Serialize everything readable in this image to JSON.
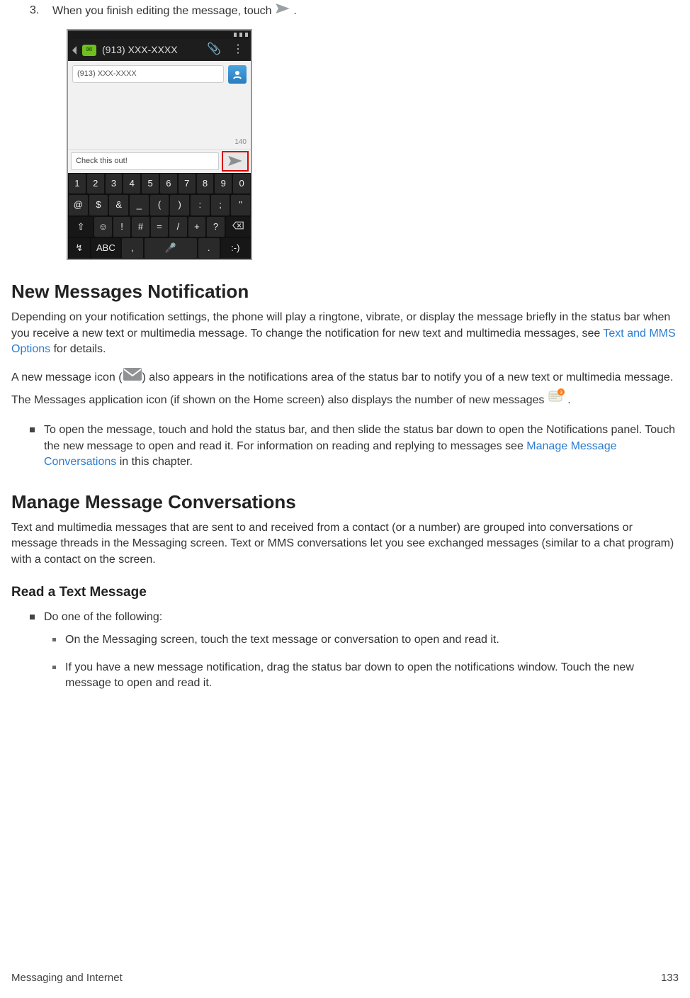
{
  "step": {
    "number": "3.",
    "text_before": "When you finish editing the message, touch ",
    "text_after": " ."
  },
  "screenshot": {
    "header_number": "(913) XXX-XXXX",
    "to_field": "(913) XXX-XXXX",
    "char_counter": "140",
    "input_text": "Check this out!",
    "rows": {
      "r1": [
        "1",
        "2",
        "3",
        "4",
        "5",
        "6",
        "7",
        "8",
        "9",
        "0"
      ],
      "r2": [
        "@",
        "$",
        "&",
        "_",
        "(",
        ")",
        ":",
        ";",
        "\""
      ],
      "r3_left": "⇧",
      "r3": [
        "☺",
        "!",
        "#",
        "=",
        "/",
        "+",
        "?"
      ],
      "r4": {
        "sym": "↯",
        "abc": "ABC",
        "comma": ",",
        "mic": "🎤",
        "dot": ".",
        "emoji": ":-)"
      }
    }
  },
  "sec1": {
    "title": "New Messages Notification",
    "p1_a": "Depending on your notification settings, the phone will play a ringtone, vibrate, or display the message briefly in the status bar when you receive a new text or multimedia message. To change the notification for new text and multimedia messages, see ",
    "p1_link": "Text and MMS Options",
    "p1_b": " for details.",
    "p2_a": "A new message icon (",
    "p2_b": ") also appears in the notifications area of the status bar to notify you of a new text or multimedia message. The Messages application icon (if shown on the Home screen) also displays the number of new messages ",
    "p2_c": " .",
    "bullet_a": "To open the message, touch and hold the status bar, and then slide the status bar down to open the Notifications panel. Touch the new message to open and read it. For information on reading and replying to messages see ",
    "bullet_link": "Manage Message Conversations",
    "bullet_b": " in this chapter."
  },
  "sec2": {
    "title": "Manage Message Conversations",
    "p1": "Text and multimedia messages that are sent to and received from a contact (or a number) are grouped into conversations or message threads in the Messaging screen. Text or MMS conversations let you see exchanged messages (similar to a chat program) with a contact on the screen."
  },
  "sec3": {
    "title": "Read a Text Message",
    "lead": "Do one of the following:",
    "b1": "On the Messaging screen, touch the text message or conversation to open and read it.",
    "b2": "If you have a new message notification, drag the status bar down to open the notifications window. Touch the new message to open and read it."
  },
  "footer": {
    "section": "Messaging and Internet",
    "page": "133"
  }
}
